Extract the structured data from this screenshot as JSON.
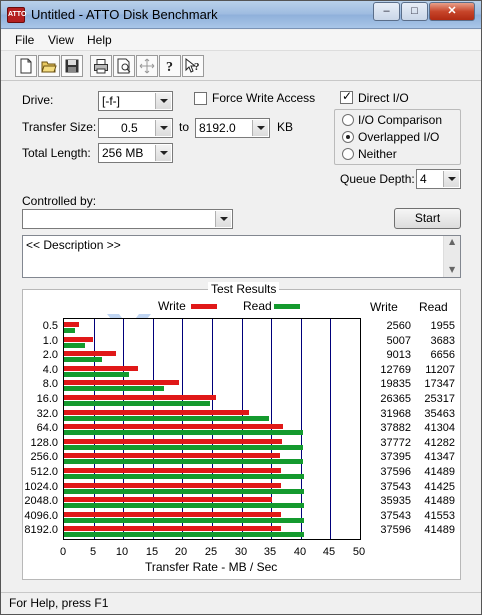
{
  "window": {
    "title": "Untitled - ATTO Disk Benchmark",
    "icon_text": "ATTO"
  },
  "title_buttons": {
    "minimize": "–",
    "maximize": "□",
    "close": "✕"
  },
  "menu": {
    "file": "File",
    "view": "View",
    "help": "Help"
  },
  "toolbar": [
    "new-document-icon",
    "open-folder-icon",
    "save-disk-icon",
    "print-icon",
    "print-preview-icon",
    "move-icon",
    "help-icon",
    "context-help-icon"
  ],
  "form": {
    "drive_label": "Drive:",
    "drive_value": "[-f-]",
    "force_write_label": "Force Write Access",
    "force_write_checked": false,
    "direct_io_label": "Direct I/O",
    "direct_io_checked": true,
    "transfer_size_label": "Transfer Size:",
    "transfer_from": "0.5",
    "transfer_to_label": "to",
    "transfer_to": "8192.0",
    "transfer_unit": "KB",
    "io_comparison_label": "I/O Comparison",
    "overlapped_io_label": "Overlapped I/O",
    "neither_label": "Neither",
    "io_mode_selected": "Overlapped I/O",
    "total_length_label": "Total Length:",
    "total_length_value": "256 MB",
    "queue_depth_label": "Queue Depth:",
    "queue_depth_value": "4",
    "controlled_by_label": "Controlled by:",
    "controlled_by_value": "",
    "start_button": "Start",
    "description": "<< Description >>"
  },
  "watermark": "xtremehardware.com",
  "colors": {
    "write": "#e01818",
    "read": "#149a2e",
    "grid": "#00007a"
  },
  "chart_data": {
    "type": "bar",
    "title": "Test Results",
    "xlabel": "Transfer Rate - MB / Sec",
    "ylabel": "",
    "legend": [
      "Write",
      "Read"
    ],
    "legend_placement": "top",
    "xlim": [
      0,
      50
    ],
    "x_ticks": [
      "0",
      "5",
      "10",
      "15",
      "20",
      "25",
      "30",
      "35",
      "40",
      "45",
      "50"
    ],
    "categories": [
      "0.5",
      "1.0",
      "2.0",
      "4.0",
      "8.0",
      "16.0",
      "32.0",
      "64.0",
      "128.0",
      "256.0",
      "512.0",
      "1024.0",
      "2048.0",
      "4096.0",
      "8192.0"
    ],
    "series": [
      {
        "name": "Write",
        "values": [
          2.5,
          4.9,
          8.8,
          12.5,
          19.4,
          25.7,
          31.2,
          37.0,
          36.9,
          36.5,
          36.7,
          36.7,
          35.1,
          36.7,
          36.7
        ]
      },
      {
        "name": "Read",
        "values": [
          1.9,
          3.6,
          6.5,
          10.9,
          16.9,
          24.7,
          34.6,
          40.3,
          40.3,
          40.4,
          40.5,
          40.5,
          40.5,
          40.6,
          40.5
        ]
      }
    ],
    "write_column": [
      "2560",
      "5007",
      "9013",
      "12769",
      "19835",
      "26365",
      "31968",
      "37882",
      "37772",
      "37395",
      "37596",
      "37543",
      "35935",
      "37543",
      "37596"
    ],
    "read_column": [
      "1955",
      "3683",
      "6656",
      "11207",
      "17347",
      "25317",
      "35463",
      "41304",
      "41282",
      "41347",
      "41489",
      "41425",
      "41489",
      "41553",
      "41489"
    ],
    "write_header": "Write",
    "read_header": "Read"
  },
  "status": "For Help, press F1"
}
